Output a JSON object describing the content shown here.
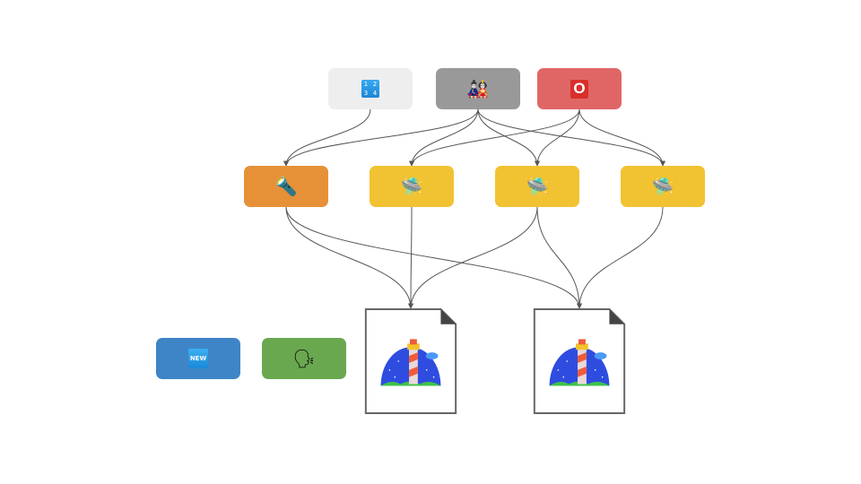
{
  "diagram": {
    "title": "",
    "nodes": [
      {
        "id": "n_input1234",
        "icon": "input-numbers-icon",
        "glyph": [
          "1",
          "2",
          "3",
          "4"
        ],
        "color": "#eeeeee",
        "row": "top"
      },
      {
        "id": "n_dolls",
        "icon": "japanese-dolls-icon",
        "glyph": "🎎",
        "color": "#999999",
        "row": "top"
      },
      {
        "id": "n_o",
        "icon": "o-button-icon",
        "glyph": "O",
        "color": "#e06666",
        "row": "top"
      },
      {
        "id": "n_flashlight",
        "icon": "flashlight-icon",
        "glyph": "🔦",
        "color": "#e69138",
        "row": "middle"
      },
      {
        "id": "n_ufo1",
        "icon": "ufo-icon",
        "glyph": "🛸",
        "color": "#f1c232",
        "row": "middle"
      },
      {
        "id": "n_ufo2",
        "icon": "ufo-icon",
        "glyph": "🛸",
        "color": "#f1c232",
        "row": "middle"
      },
      {
        "id": "n_ufo3",
        "icon": "ufo-icon",
        "glyph": "🛸",
        "color": "#f1c232",
        "row": "middle"
      },
      {
        "id": "n_doc1",
        "icon": "lighthouse-document-icon",
        "row": "bottom"
      },
      {
        "id": "n_doc2",
        "icon": "lighthouse-document-icon",
        "row": "bottom"
      },
      {
        "id": "n_new",
        "icon": "new-button-icon",
        "glyph": "NEW",
        "color": "#3d85c6",
        "row": "legend"
      },
      {
        "id": "n_speaking",
        "icon": "speaking-head-icon",
        "glyph": "🗣",
        "color": "#6aa84f",
        "row": "legend"
      }
    ],
    "edges": [
      [
        "n_input1234",
        "n_flashlight"
      ],
      [
        "n_dolls",
        "n_flashlight"
      ],
      [
        "n_dolls",
        "n_ufo1"
      ],
      [
        "n_dolls",
        "n_ufo2"
      ],
      [
        "n_dolls",
        "n_ufo3"
      ],
      [
        "n_o",
        "n_ufo1"
      ],
      [
        "n_o",
        "n_ufo2"
      ],
      [
        "n_o",
        "n_ufo3"
      ],
      [
        "n_flashlight",
        "n_doc1"
      ],
      [
        "n_flashlight",
        "n_doc2"
      ],
      [
        "n_ufo1",
        "n_doc1"
      ],
      [
        "n_ufo2",
        "n_doc1"
      ],
      [
        "n_ufo2",
        "n_doc2"
      ],
      [
        "n_ufo3",
        "n_doc2"
      ]
    ],
    "edge_color": "#555555"
  }
}
